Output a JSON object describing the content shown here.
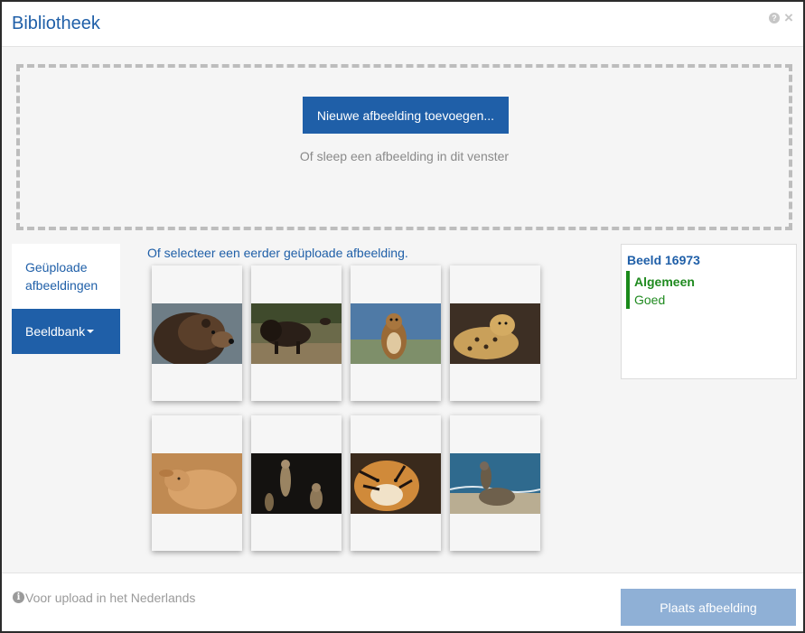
{
  "header": {
    "title": "Bibliotheek",
    "help_glyph": "?",
    "close_glyph": "×"
  },
  "dropzone": {
    "add_button_label": "Nieuwe afbeelding toevoegen...",
    "hint": "Of sleep een afbeelding in dit venster"
  },
  "sidebar": {
    "items": [
      {
        "label": "Geüploade afbeeldingen",
        "active": false
      },
      {
        "label": "Beeldbank",
        "active": true,
        "has_dropdown": true
      }
    ]
  },
  "gallery": {
    "label": "Of selecteer een eerder geüploade afbeelding.",
    "images": [
      {
        "subject": "bear"
      },
      {
        "subject": "bison"
      },
      {
        "subject": "squirrel"
      },
      {
        "subject": "leopard"
      },
      {
        "subject": "goat"
      },
      {
        "subject": "meerkats"
      },
      {
        "subject": "tiger"
      },
      {
        "subject": "sea-lion"
      }
    ]
  },
  "info_panel": {
    "title": "Beeld 16973",
    "category": "Algemeen",
    "value": "Goed"
  },
  "footer": {
    "info_glyph": "i",
    "info_text": "Voor upload in het Nederlands",
    "place_button_label": "Plaats afbeelding"
  },
  "colors": {
    "brand": "#1f5fa8",
    "brand_disabled": "#8fb0d6",
    "success": "#1f8a1f"
  }
}
